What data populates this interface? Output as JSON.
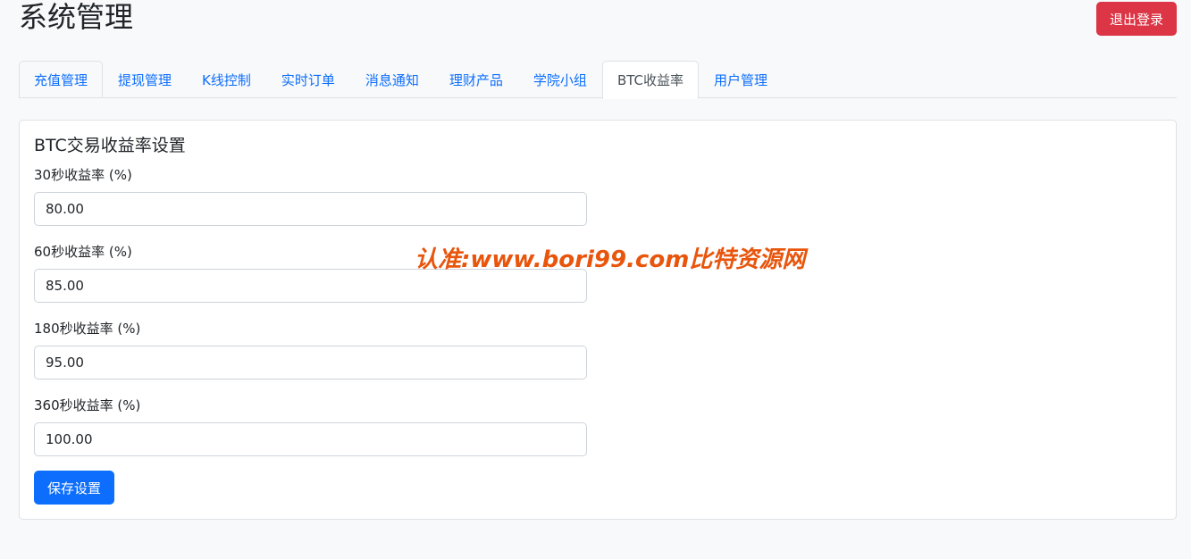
{
  "header": {
    "title": "系统管理",
    "logout_label": "退出登录"
  },
  "tabs": [
    {
      "label": "充值管理"
    },
    {
      "label": "提现管理"
    },
    {
      "label": "K线控制"
    },
    {
      "label": "实时订单"
    },
    {
      "label": "消息通知"
    },
    {
      "label": "理财产品"
    },
    {
      "label": "学院小组"
    },
    {
      "label": "BTC收益率",
      "active": true
    },
    {
      "label": "用户管理"
    }
  ],
  "settings": {
    "title": "BTC交易收益率设置",
    "fields": [
      {
        "label": "30秒收益率 (%)",
        "value": "80.00"
      },
      {
        "label": "60秒收益率 (%)",
        "value": "85.00"
      },
      {
        "label": "180秒收益率 (%)",
        "value": "95.00"
      },
      {
        "label": "360秒收益率 (%)",
        "value": "100.00"
      }
    ],
    "save_label": "保存设置"
  },
  "watermark": "认准:www.bori99.com比特资源网",
  "colors": {
    "primary": "#0d6efd",
    "danger": "#dc3545",
    "watermark": "#e8550c"
  }
}
